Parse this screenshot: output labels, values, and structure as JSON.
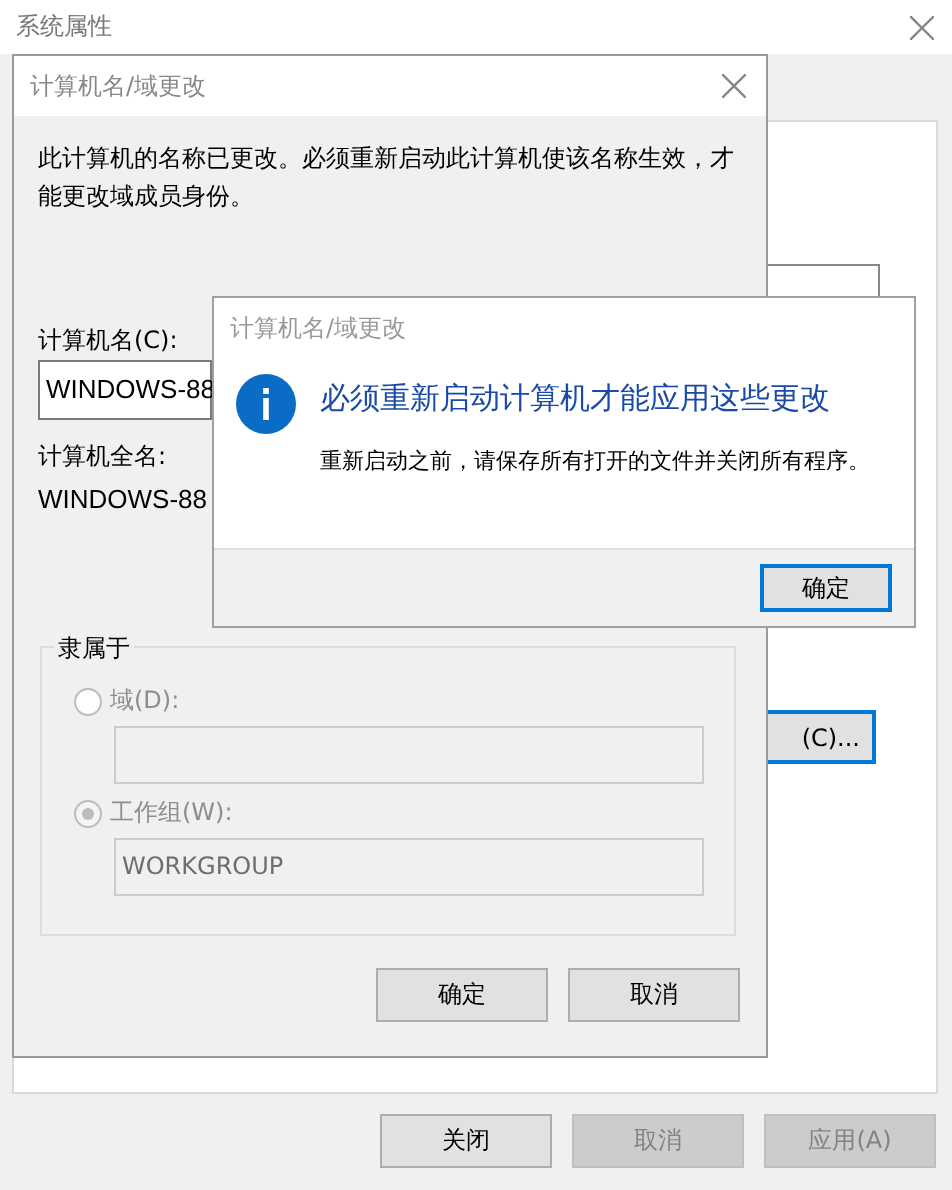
{
  "window": {
    "title": "系统属性"
  },
  "background": {
    "change_button": "(C)...",
    "buttons": [
      {
        "label": "关闭",
        "disabled": false
      },
      {
        "label": "取消",
        "disabled": true
      },
      {
        "label": "应用(A)",
        "disabled": true
      }
    ]
  },
  "dialog": {
    "title": "计算机名/域更改",
    "message": "此计算机的名称已更改。必须重新启动此计算机使该名称生效，才能更改域成员身份。",
    "computer_name_label": "计算机名(C):",
    "computer_name": "WINDOWS-88",
    "full_name_label": "计算机全名:",
    "full_name": "WINDOWS-88",
    "member_of": {
      "label": "隶属于",
      "options": [
        {
          "label": "域(D):",
          "selected": false,
          "disabled": true
        },
        {
          "label": "工作组(W):",
          "selected": true,
          "disabled": true,
          "value": "WORKGROUP"
        }
      ]
    },
    "buttons": [
      "确定",
      "取消"
    ]
  },
  "message_box": {
    "title": "计算机名/域更改",
    "heading": "必须重新启动计算机才能应用这些更改",
    "text": "重新启动之前，请保存所有打开的文件并关闭所有程序。",
    "button": "确定"
  }
}
